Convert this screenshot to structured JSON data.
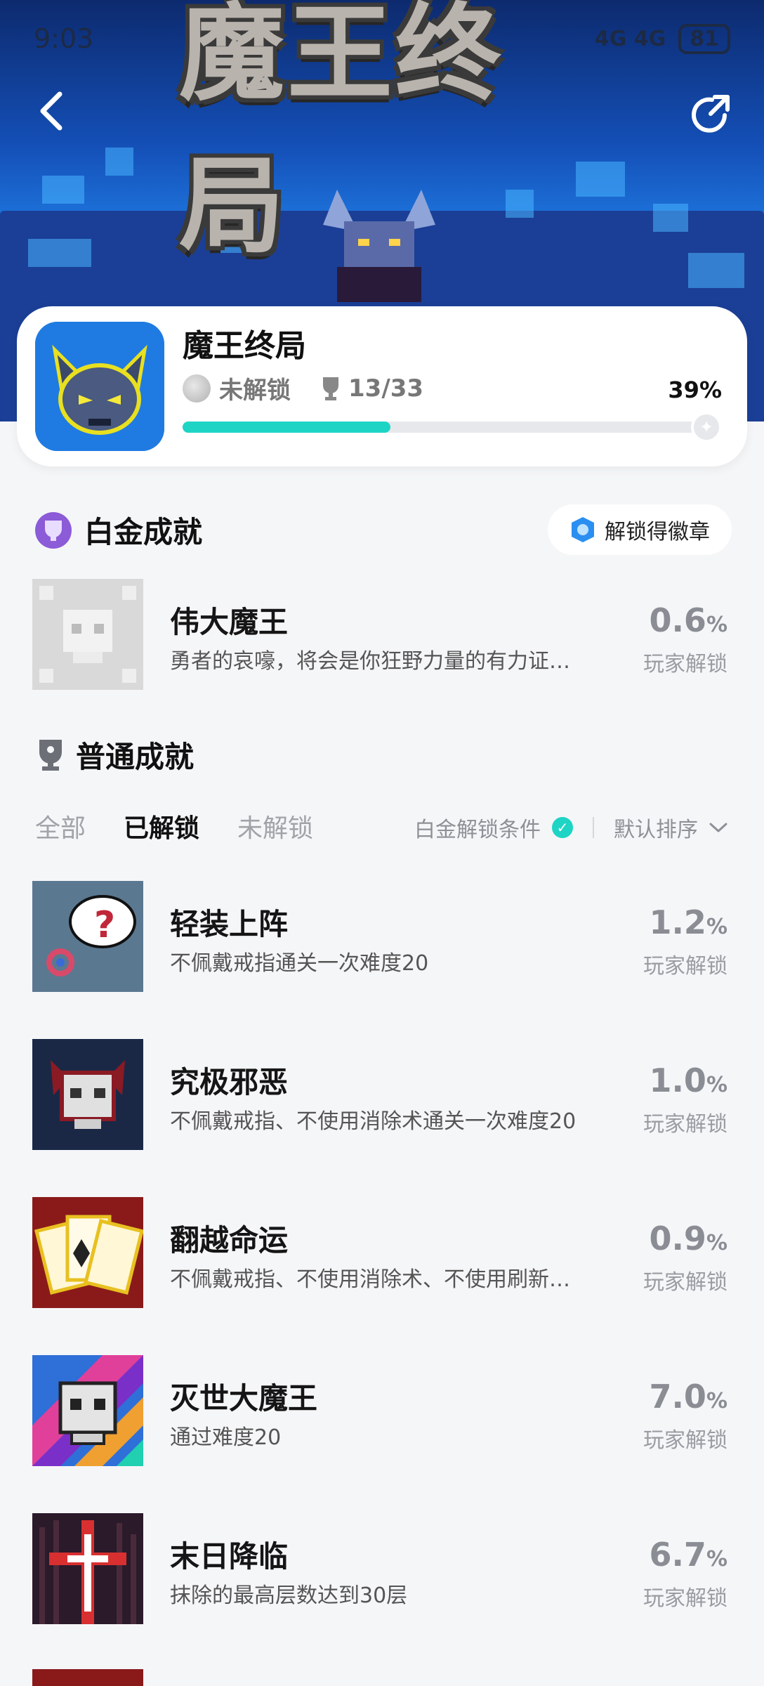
{
  "status_bar": {
    "time": "9:03",
    "indicators": "4G 4G",
    "battery": "81"
  },
  "hero": {
    "title": "魔王终局"
  },
  "game": {
    "name": "魔王终局",
    "lock_status": "未解锁",
    "trophy_progress": "13/33",
    "percent": "39%",
    "progress_fraction": 0.39
  },
  "platinum": {
    "title": "白金成就",
    "badge_button": "解锁得徽章",
    "items": [
      {
        "title": "伟大魔王",
        "desc": "勇者的哀嚎，将会是你狂野力量的有力证…",
        "rate": "0.6",
        "rate_unit": "%",
        "rate_label": "玩家解锁"
      }
    ]
  },
  "normal": {
    "title": "普通成就",
    "tabs": [
      "全部",
      "已解锁",
      "未解锁"
    ],
    "active_tab": "已解锁",
    "filter_label": "白金解锁条件",
    "sort_label": "默认排序",
    "items": [
      {
        "title": "轻装上阵",
        "desc": "不佩戴戒指通关一次难度20",
        "rate": "1.2",
        "rate_unit": "%",
        "rate_label": "玩家解锁"
      },
      {
        "title": "究极邪恶",
        "desc": "不佩戴戒指、不使用消除术通关一次难度20",
        "rate": "1.0",
        "rate_unit": "%",
        "rate_label": "玩家解锁"
      },
      {
        "title": "翻越命运",
        "desc": "不佩戴戒指、不使用消除术、不使用刷新…",
        "rate": "0.9",
        "rate_unit": "%",
        "rate_label": "玩家解锁"
      },
      {
        "title": "灭世大魔王",
        "desc": "通过难度20",
        "rate": "7.0",
        "rate_unit": "%",
        "rate_label": "玩家解锁"
      },
      {
        "title": "末日降临",
        "desc": "抹除的最高层数达到30层",
        "rate": "6.7",
        "rate_unit": "%",
        "rate_label": "玩家解锁"
      }
    ]
  },
  "colors": {
    "accent": "#1ed4c4",
    "background": "#f5f6f8",
    "hero_blue": "#1450b8"
  }
}
